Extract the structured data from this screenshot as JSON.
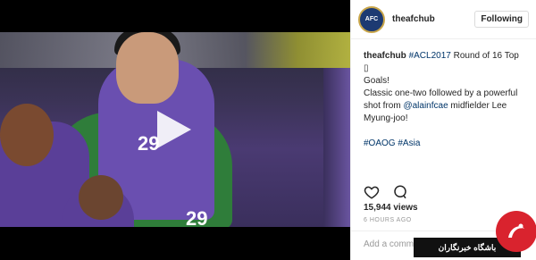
{
  "post": {
    "username": "theafchub",
    "follow_label": "Following",
    "avatar_text": "AFC",
    "caption": {
      "author": "theafchub",
      "line1_tag": "#ACL2017",
      "line1_rest": " Round of 16 Top ▯",
      "line2": "Goals!",
      "line3": "Classic one-two followed by a powerful",
      "line4_pre": "shot from ",
      "line4_mention": "@alainfcae",
      "line4_post": " midfielder Lee",
      "line5": "Myung-joo!",
      "tag_oaog": "#OAOG",
      "tag_asia": "#Asia"
    },
    "views": "15,944 views",
    "time": "6 HOURS AGO",
    "comment_placeholder": "Add a comme"
  },
  "video": {
    "jersey_number_1": "29",
    "jersey_number_2": "29"
  },
  "watermark": {
    "text": "باشگاه خبرنگاران"
  },
  "colors": {
    "link": "#003569",
    "watermark_red": "#d9232e"
  }
}
